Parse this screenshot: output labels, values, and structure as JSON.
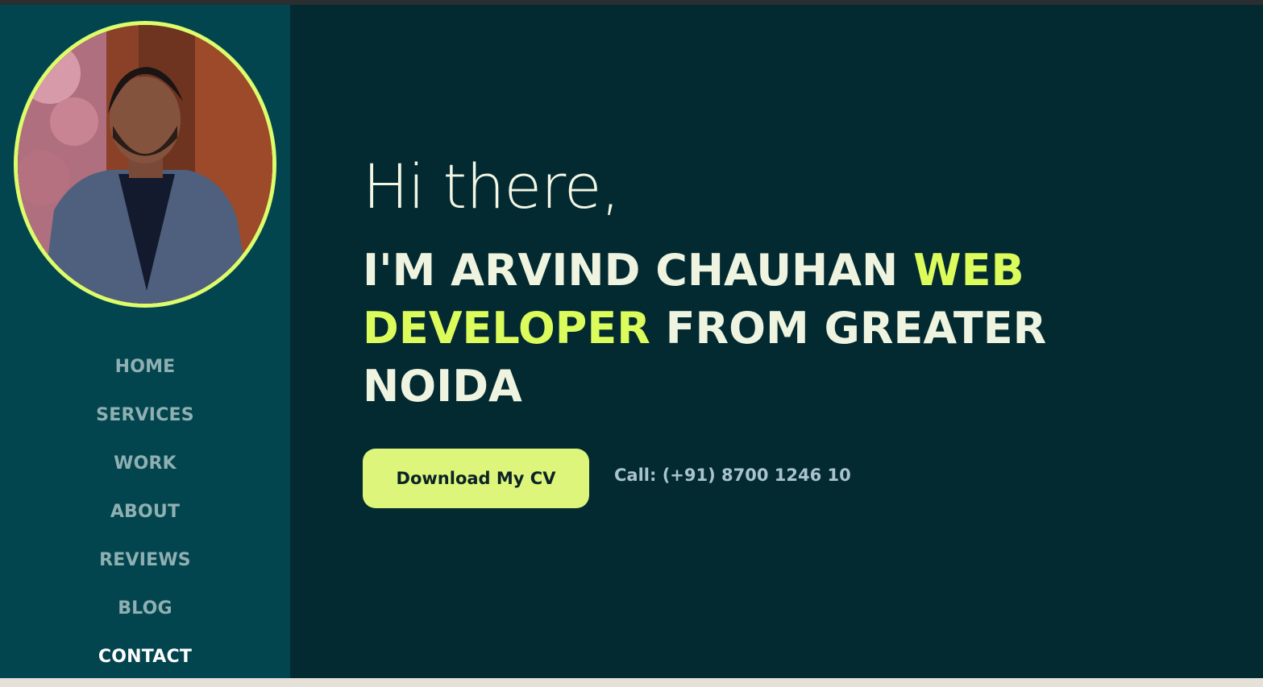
{
  "sidebar": {
    "nav": [
      {
        "label": "HOME"
      },
      {
        "label": "SERVICES"
      },
      {
        "label": "WORK"
      },
      {
        "label": "ABOUT"
      },
      {
        "label": "REVIEWS"
      },
      {
        "label": "BLOG"
      },
      {
        "label": "CONTACT",
        "active": true
      }
    ]
  },
  "hero": {
    "greeting": "Hi there,",
    "headline_prefix": "I'M ARVIND CHAUHAN ",
    "headline_accent": "WEB DEVELOPER",
    "headline_suffix": " FROM GREATER NOIDA",
    "cv_button": "Download My CV",
    "call_text": "Call: (+91) 8700 1246 10"
  },
  "colors": {
    "sidebar_bg": "#03454f",
    "main_bg": "#032a31",
    "accent": "#dcfc5c",
    "button_bg": "#dcf57a"
  }
}
